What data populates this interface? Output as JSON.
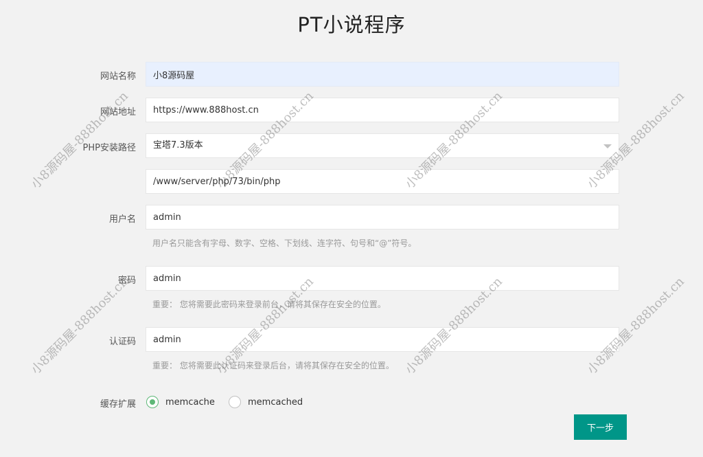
{
  "page": {
    "title": "PT小说程序"
  },
  "form": {
    "site_name": {
      "label": "网站名称",
      "value": "小8源码屋"
    },
    "site_url": {
      "label": "网站地址",
      "value": "https://www.888host.cn"
    },
    "php_path": {
      "label": "PHP安装路径",
      "selected": "宝塔7.3版本",
      "path_value": "/www/server/php/73/bin/php"
    },
    "username": {
      "label": "用户名",
      "value": "admin",
      "hint": "用户名只能含有字母、数字、空格、下划线、连字符、句号和“@”符号。"
    },
    "password": {
      "label": "密码",
      "value": "admin",
      "hint": "重要： 您将需要此密码来登录前台，请将其保存在安全的位置。"
    },
    "auth_code": {
      "label": "认证码",
      "value": "admin",
      "hint": "重要： 您将需要此认证码来登录后台，请将其保存在安全的位置。"
    },
    "cache": {
      "label": "缓存扩展",
      "options": [
        "memcache",
        "memcached"
      ],
      "selected": "memcache"
    },
    "next_label": "下一步"
  },
  "watermark": {
    "text": "小8源码屋-888host.cn"
  },
  "colors": {
    "accent": "#009688",
    "radio_checked": "#5fb878",
    "autofill_bg": "#e8f0fe"
  }
}
